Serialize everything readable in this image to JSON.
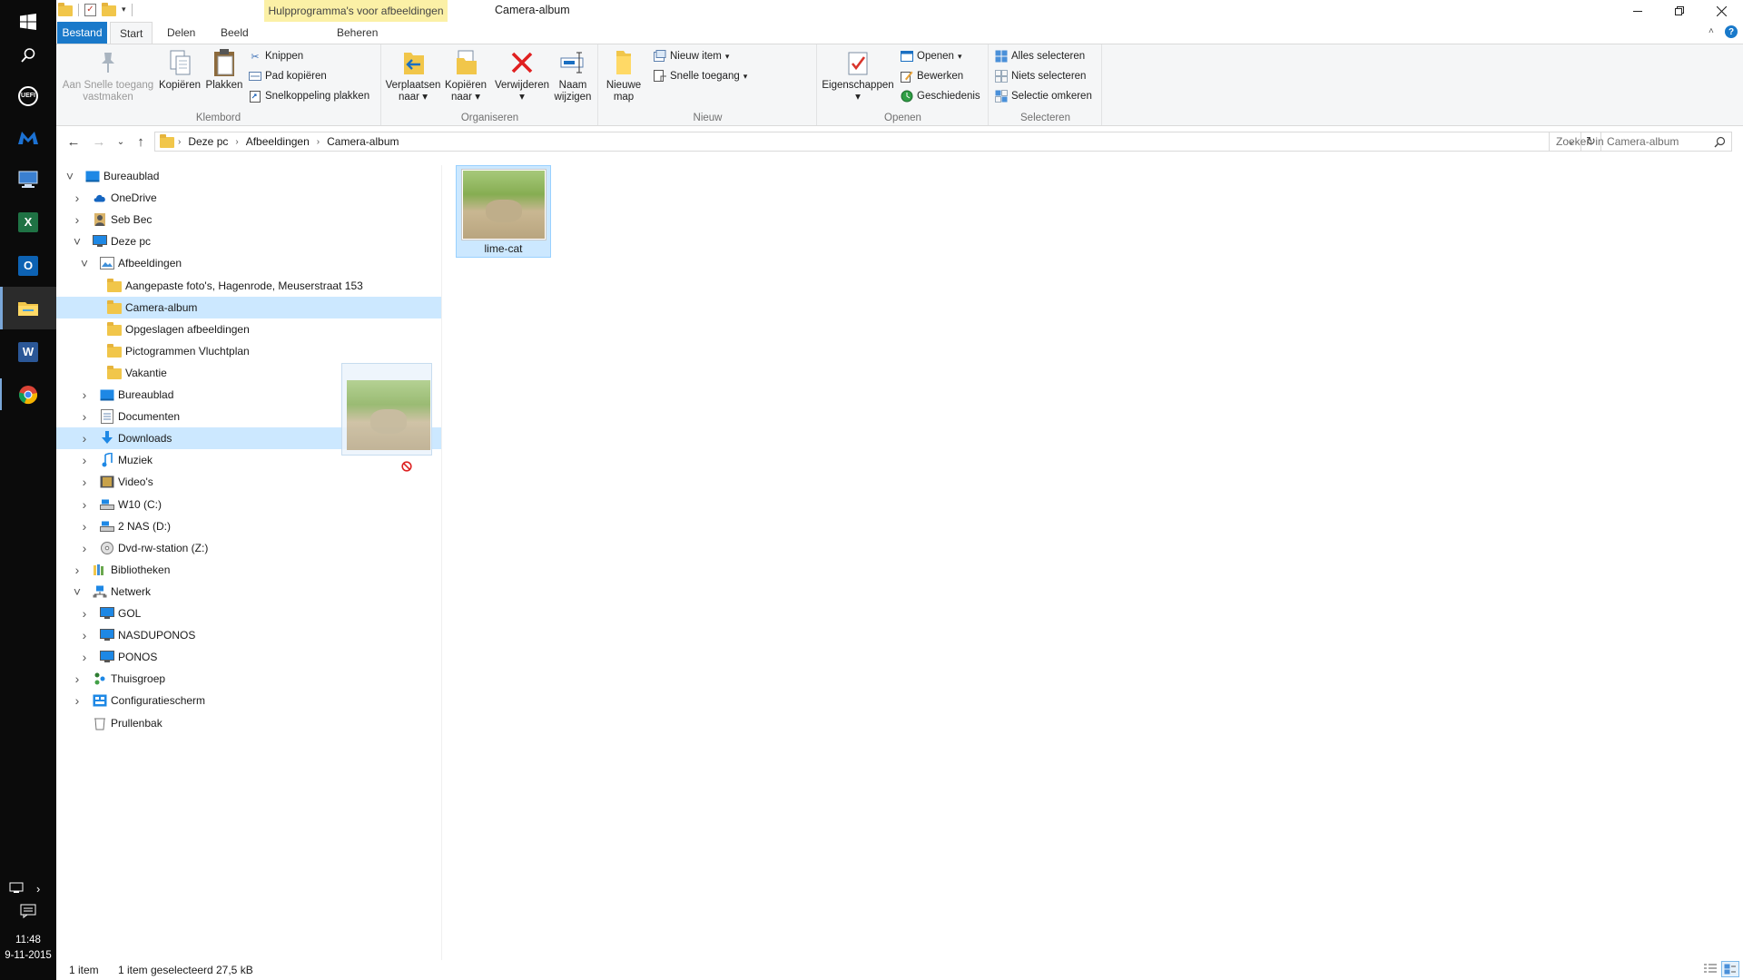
{
  "taskbar": {
    "clock_time": "11:48",
    "clock_date": "9-11-2015",
    "apps": [
      "windows-start",
      "search",
      "uefi-app",
      "malwarebytes",
      "remote-desktop",
      "excel",
      "outlook",
      "file-explorer",
      "word",
      "chrome"
    ]
  },
  "window": {
    "title": "Camera-album",
    "context_header": "Hulpprogramma's voor afbeeldingen"
  },
  "tabs": {
    "file": "Bestand",
    "start": "Start",
    "share": "Delen",
    "view": "Beeld",
    "manage": "Beheren"
  },
  "ribbon": {
    "clipboard": {
      "label": "Klembord",
      "pin_line1": "Aan Snelle toegang",
      "pin_line2": "vastmaken",
      "copy": "Kopiëren",
      "paste": "Plakken",
      "cut": "Knippen",
      "copy_path": "Pad kopiëren",
      "paste_shortcut": "Snelkoppeling plakken"
    },
    "organize": {
      "label": "Organiseren",
      "move_line1": "Verplaatsen",
      "move_line2": "naar",
      "copy_line1": "Kopiëren",
      "copy_line2": "naar",
      "delete": "Verwijderen",
      "rename_line1": "Naam",
      "rename_line2": "wijzigen"
    },
    "new": {
      "label": "Nieuw",
      "folder_line1": "Nieuwe",
      "folder_line2": "map",
      "new_item": "Nieuw item",
      "easy_access": "Snelle toegang"
    },
    "open": {
      "label": "Openen",
      "properties": "Eigenschappen",
      "open": "Openen",
      "edit": "Bewerken",
      "history": "Geschiedenis"
    },
    "select": {
      "label": "Selecteren",
      "select_all": "Alles selecteren",
      "select_none": "Niets selecteren",
      "invert": "Selectie omkeren"
    }
  },
  "address": {
    "crumbs": [
      "Deze pc",
      "Afbeeldingen",
      "Camera-album"
    ],
    "search_placeholder": "Zoeken in Camera-album"
  },
  "tree": [
    {
      "label": "Bureaublad",
      "icon": "desktop-icon"
    },
    {
      "label": "OneDrive",
      "icon": "cloud-icon"
    },
    {
      "label": "Seb Bec",
      "icon": "user-icon"
    },
    {
      "label": "Deze pc",
      "icon": "pc-icon"
    },
    {
      "label": "Afbeeldingen",
      "icon": "pictures-icon"
    },
    {
      "label": "Aangepaste foto's, Hagenrode, Meuserstraat 153",
      "icon": "folder-icon"
    },
    {
      "label": "Camera-album",
      "icon": "folder-icon"
    },
    {
      "label": "Opgeslagen afbeeldingen",
      "icon": "folder-icon"
    },
    {
      "label": "Pictogrammen Vluchtplan",
      "icon": "folder-icon"
    },
    {
      "label": "Vakantie",
      "icon": "folder-icon"
    },
    {
      "label": "Bureaublad",
      "icon": "desktop-icon"
    },
    {
      "label": "Documenten",
      "icon": "documents-icon"
    },
    {
      "label": "Downloads",
      "icon": "downloads-icon"
    },
    {
      "label": "Muziek",
      "icon": "music-icon"
    },
    {
      "label": "Video's",
      "icon": "video-icon"
    },
    {
      "label": "W10 (C:)",
      "icon": "drive-icon"
    },
    {
      "label": "2 NAS (D:)",
      "icon": "drive-icon"
    },
    {
      "label": "Dvd-rw-station (Z:)",
      "icon": "dvd-icon"
    },
    {
      "label": "Bibliotheken",
      "icon": "libraries-icon"
    },
    {
      "label": "Netwerk",
      "icon": "network-icon"
    },
    {
      "label": "GOL",
      "icon": "computer-icon"
    },
    {
      "label": "NASDUPONOS",
      "icon": "computer-icon"
    },
    {
      "label": "PONOS",
      "icon": "computer-icon"
    },
    {
      "label": "Thuisgroep",
      "icon": "homegroup-icon"
    },
    {
      "label": "Configuratiescherm",
      "icon": "control-panel-icon"
    },
    {
      "label": "Prullenbak",
      "icon": "recycle-bin-icon"
    }
  ],
  "content": {
    "file_name": "lime-cat"
  },
  "status": {
    "count": "1 item",
    "selection": "1 item geselecteerd",
    "size": "27,5 kB"
  },
  "colors": {
    "file_tab": "#1979ca",
    "selection": "#cce8ff",
    "context_tab": "#fbf0a6",
    "taskbar": "#0b0b0b"
  }
}
